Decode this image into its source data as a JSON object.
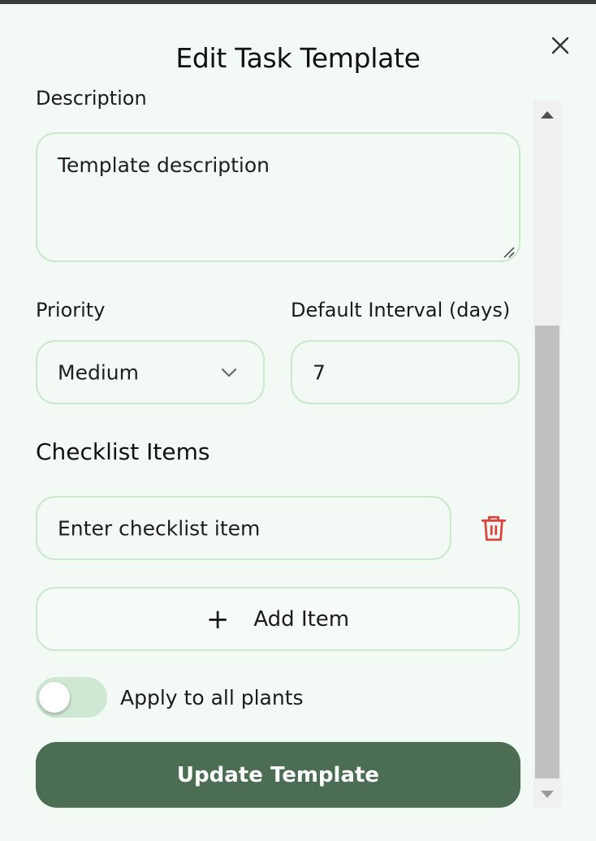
{
  "dialog": {
    "title": "Edit Task Template",
    "close_icon": "close-icon"
  },
  "form": {
    "description_label": "Description",
    "description_value": "Template description",
    "priority_label": "Priority",
    "priority_value": "Medium",
    "interval_label": "Default Interval (days)",
    "interval_value": "7",
    "checklist_title": "Checklist Items",
    "checklist_placeholder": "Enter checklist item",
    "delete_icon": "trash-icon",
    "add_item_label": "Add Item",
    "add_icon": "plus-icon",
    "apply_all_label": "Apply to all plants",
    "apply_all_on": false,
    "submit_label": "Update Template"
  },
  "colors": {
    "background": "#f3f9f4",
    "field_border": "#c9e8cc",
    "primary": "#4a6d53",
    "danger": "#d9443f",
    "toggle_track": "#cfe8d4"
  }
}
